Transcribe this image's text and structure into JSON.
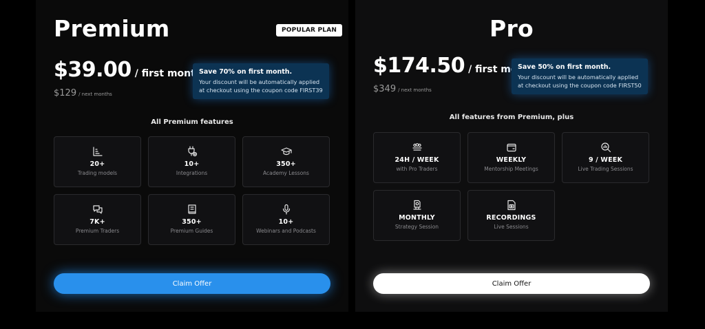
{
  "premium": {
    "title": "Premium",
    "badge": "POPULAR PLAN",
    "price": "$39.00",
    "period": "/ first month",
    "old_price": "$129",
    "next_label": "/ next months",
    "discount_title": "Save 70% on first month.",
    "discount_text": "Your discount will be automatically applied at checkout using the coupon code FIRST39",
    "features_heading": "All Premium features",
    "features": [
      {
        "icon": "chart-icon",
        "title": "20+",
        "sub": "Trading models"
      },
      {
        "icon": "plug-icon",
        "title": "10+",
        "sub": "Integrations"
      },
      {
        "icon": "graduation-cap-icon",
        "title": "350+",
        "sub": "Academy Lessons"
      },
      {
        "icon": "chat-bubbles-icon",
        "title": "7K+",
        "sub": "Premium Traders"
      },
      {
        "icon": "book-icon",
        "title": "350+",
        "sub": "Premium Guides"
      },
      {
        "icon": "microphone-icon",
        "title": "10+",
        "sub": "Webinars and Podcasts"
      }
    ],
    "cta": "Claim Offer"
  },
  "pro": {
    "title": "Pro",
    "price": "$174.50",
    "period": "/ first month",
    "old_price": "$349",
    "next_label": "/ next months",
    "discount_title": "Save 50% on first month.",
    "discount_text": "Your discount will be automatically applied at checkout using the coupon code FIRST50",
    "features_heading": "All features from Premium, plus",
    "features": [
      {
        "icon": "group-icon",
        "title": "24H / WEEK",
        "sub": "with Pro Traders"
      },
      {
        "icon": "wallet-icon",
        "title": "WEEKLY",
        "sub": "Mentorship Meetings"
      },
      {
        "icon": "magnifier-chart-icon",
        "title": "9 / WEEK",
        "sub": "Live Trading Sessions"
      },
      {
        "icon": "strategy-doc-icon",
        "title": "MONTHLY",
        "sub": "Strategy Session"
      },
      {
        "icon": "recording-icon",
        "title": "RECORDINGS",
        "sub": "Live Sessions"
      }
    ],
    "cta": "Claim Offer"
  },
  "colors": {
    "background": "#000000",
    "premium_accent": "#2990ec",
    "discount_box": "#0c3353",
    "pro_button": "#ffffff"
  }
}
